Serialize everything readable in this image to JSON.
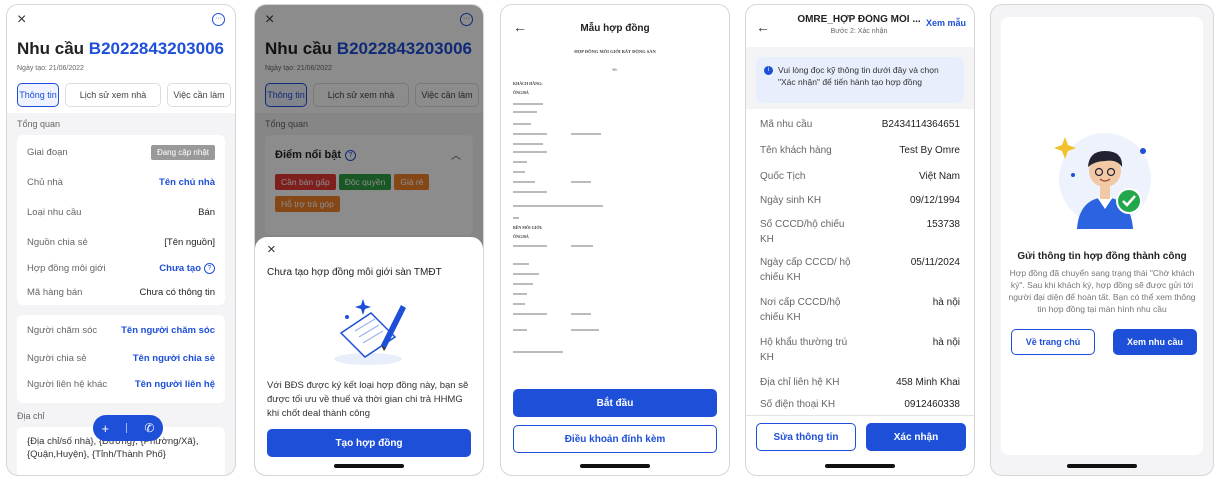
{
  "screen1": {
    "close": "×",
    "title_prefix": "Nhu cầu",
    "title_code": "B2022843203006",
    "created": "Ngày tạo: 21/06/2022",
    "tabs": [
      "Thông tin",
      "Lịch sử xem nhà",
      "Việc cần làm"
    ],
    "section_overview": "Tổng quan",
    "rows": [
      {
        "k": "Giai đoạn",
        "v": "Đang cập nhật"
      },
      {
        "k": "Chủ nhà",
        "v": "Tên chủ nhà"
      },
      {
        "k": "Loại nhu cầu",
        "v": "Bán"
      },
      {
        "k": "Nguồn chia sẻ",
        "v": "[Tên nguồn]"
      },
      {
        "k": "Hợp đồng môi giới",
        "v": "Chưa tạo"
      },
      {
        "k": "Mã hàng bán",
        "v": "Chưa có thông tin"
      }
    ],
    "people": [
      {
        "k": "Người chăm sóc",
        "v": "Tên người chăm sóc"
      },
      {
        "k": "Người chia sẻ",
        "v": "Tên người chia sẻ"
      },
      {
        "k": "Người liên hệ khác",
        "v": "Tên người liên hệ"
      }
    ],
    "address_label": "Địa chỉ",
    "address_text": "{Địa chỉ/số nhà}, {Đường}, {Phường/Xã}, {Quận,Huyện}, {Tỉnh/Thành Phố}",
    "fab_plus": "+",
    "fab_phone": "✆"
  },
  "screen2": {
    "close": "×",
    "title_prefix": "Nhu cầu",
    "title_code": "B2022843203006",
    "created": "Ngày tạo: 21/06/2022",
    "tabs": [
      "Thông tin",
      "Lịch sử xem nhà",
      "Việc cần làm"
    ],
    "section_overview": "Tổng quan",
    "highlights_title": "Điểm nổi bật",
    "tags": [
      {
        "label": "Cần bán gấp",
        "color": "#e53935"
      },
      {
        "label": "Độc quyền",
        "color": "#2e9e43"
      },
      {
        "label": "Giá rẻ",
        "color": "#f4822a"
      },
      {
        "label": "Hỗ trợ trả góp",
        "color": "#f4822a"
      }
    ],
    "sheet_close": "×",
    "sheet_title": "Chưa tạo hợp đồng môi giới sàn TMĐT",
    "sheet_body": "Với BĐS được ký kết loại hợp đồng này, bạn sẽ được tối ưu về thuế và thời gian chi trả HHMG khi chốt deal thành công",
    "sheet_button": "Tạo hợp đồng"
  },
  "screen3": {
    "back": "←",
    "title": "Mẫu hợp đồng",
    "doc_heading": "HỢP ĐỒNG MÔI GIỚI BẤT ĐỘNG SẢN",
    "doc_sub": "Số:",
    "doc_party_a": "KHÁCH HÀNG:",
    "doc_party_b": "BÊN MÔI GIỚI:",
    "doc_partner": "ÔNG/BÀ",
    "start_button": "Bắt đầu",
    "terms_button": "Điều khoản đính kèm"
  },
  "screen4": {
    "back": "←",
    "title": "OMRE_HỢP ĐỒNG MÔI ...",
    "subtitle": "Bước 2: Xác nhận",
    "preview": "Xem mẫu",
    "notice": "Vui lòng đọc kỹ thông tin dưới đây và chọn \"Xác nhận\" để tiến hành tạo hợp đồng",
    "rows": [
      {
        "k": "Mã nhu cầu",
        "v": "B2434114364651"
      },
      {
        "k": "Tên khách hàng",
        "v": "Test By Omre"
      },
      {
        "k": "Quốc Tịch",
        "v": "Việt Nam"
      },
      {
        "k": "Ngày sinh KH",
        "v": "09/12/1994"
      },
      {
        "k": "Số CCCD/hộ chiếu KH",
        "v": "153738"
      },
      {
        "k": "Ngày cấp CCCD/ hộ chiếu KH",
        "v": "05/11/2024"
      },
      {
        "k": "Nơi cấp CCCD/hộ chiếu KH",
        "v": "hà nội"
      },
      {
        "k": "Hộ khẩu thường trú KH",
        "v": "hà nội"
      },
      {
        "k": "Địa chỉ liên hệ KH",
        "v": "458 Minh Khai"
      },
      {
        "k": "Số điện thoại KH",
        "v": "0912460338"
      }
    ],
    "edit_button": "Sửa thông tin",
    "confirm_button": "Xác nhận"
  },
  "screen5": {
    "title": "Gửi thông tin hợp đồng thành công",
    "body": "Hợp đồng đã chuyển sang trạng thái \"Chờ khách ký\". Sau khi khách ký, hợp đồng sẽ được gửi tới người đại diện để hoàn tất. Bạn có thể xem thông tin hợp đồng tại màn hình nhu cầu",
    "home_button": "Về trang chủ",
    "view_button": "Xem nhu cầu"
  },
  "colors": {
    "primary": "#1d4fd8",
    "overlay": "rgba(0,0,0,0.45)",
    "success": "#22a84a"
  }
}
